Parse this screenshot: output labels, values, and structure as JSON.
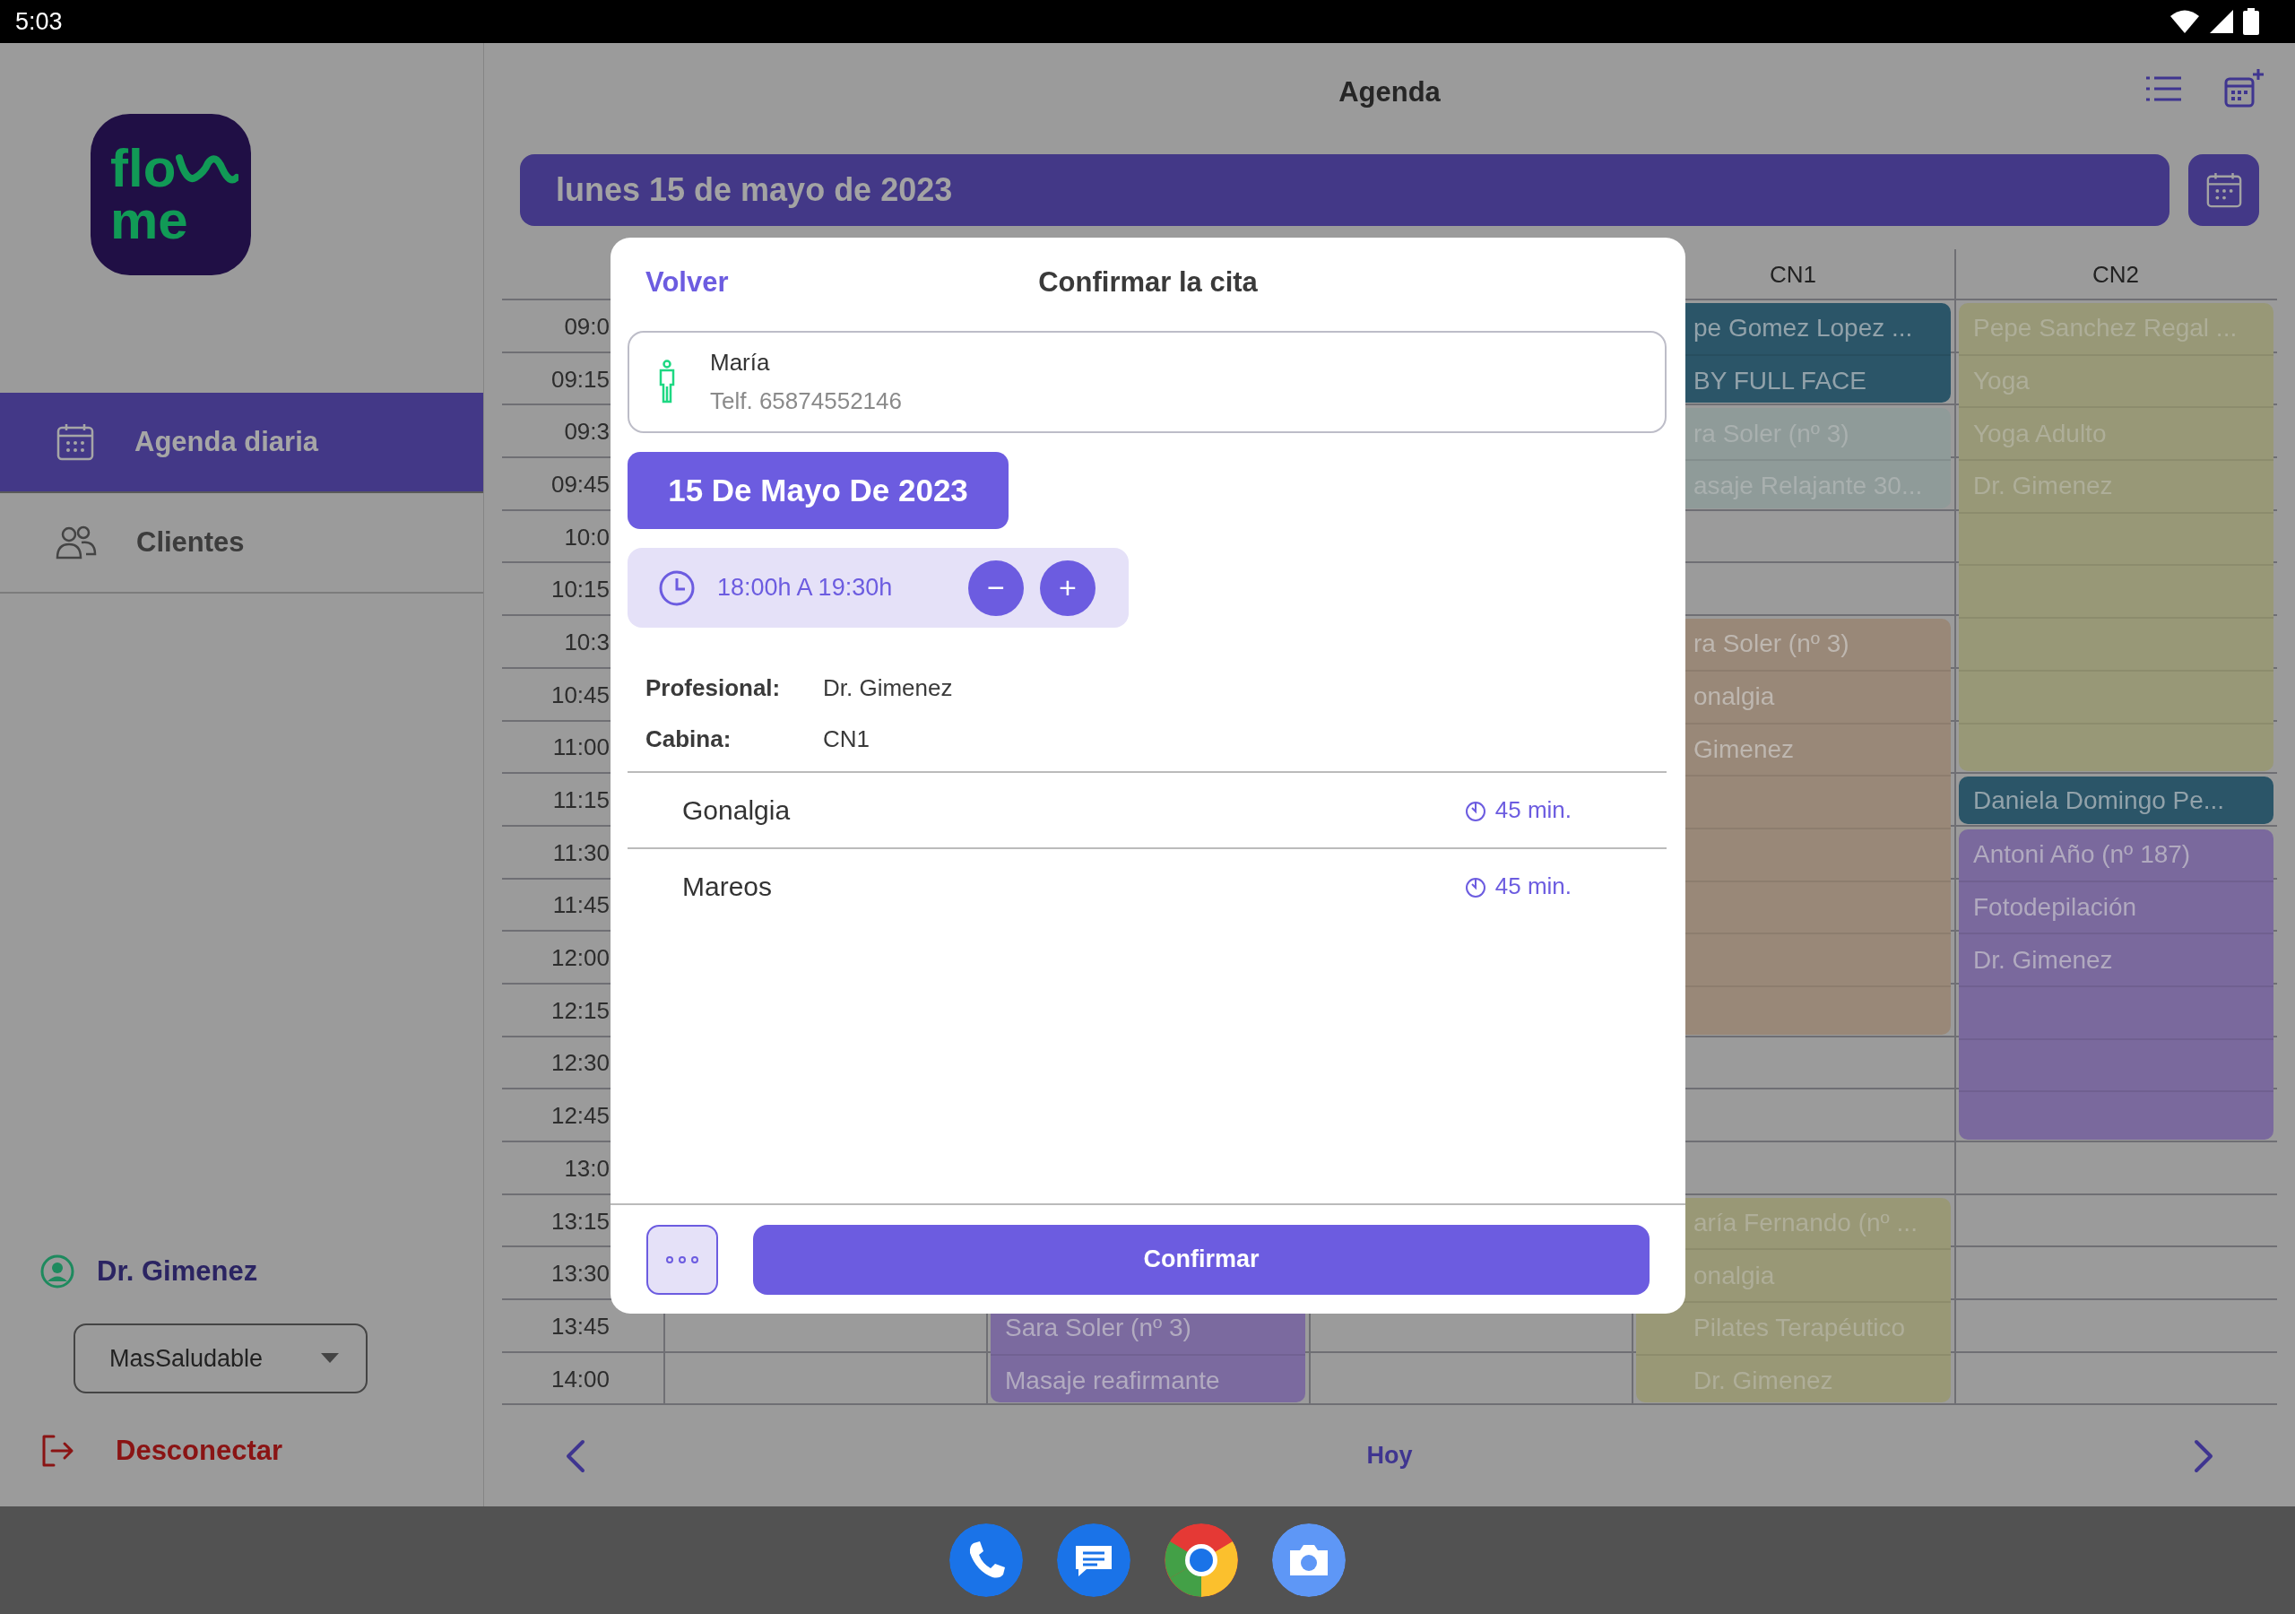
{
  "status_bar": {
    "time": "5:03"
  },
  "sidebar": {
    "logo": {
      "line_1": "flo",
      "line_2": "me"
    },
    "nav": [
      {
        "label": "Agenda diaria",
        "selected": true
      },
      {
        "label": "Clientes",
        "selected": false
      }
    ],
    "user": {
      "name": "Dr. Gimenez"
    },
    "center_select": {
      "value": "MasSaludable"
    },
    "logout": {
      "label": "Desconectar"
    }
  },
  "header": {
    "title": "Agenda"
  },
  "date_bar": {
    "label": "lunes 15 de mayo de 2023"
  },
  "calendar": {
    "times": [
      "09:0",
      "09:15",
      "09:3",
      "09:45",
      "10:0",
      "10:15",
      "10:3",
      "10:45",
      "11:00",
      "11:15",
      "11:30",
      "11:45",
      "12:00",
      "12:15",
      "12:30",
      "12:45",
      "13:0",
      "13:15",
      "13:30",
      "13:45",
      "14:00"
    ],
    "columns": [
      {
        "kind": "covered"
      },
      {
        "kind": "covered",
        "slots": [
          {
            "kind": "free"
          },
          {
            "kind": "free"
          },
          {
            "kind": "free"
          },
          {
            "kind": "free"
          },
          {
            "kind": "free"
          },
          {
            "kind": "free"
          },
          {
            "kind": "free"
          },
          {
            "kind": "free"
          },
          {
            "kind": "free"
          },
          {
            "kind": "free"
          },
          {
            "kind": "free"
          },
          {
            "kind": "free"
          },
          {
            "kind": "free"
          },
          {
            "kind": "free"
          },
          {
            "kind": "free"
          },
          {
            "kind": "free"
          },
          {
            "kind": "free"
          },
          {
            "kind": "free"
          },
          {
            "kind": "free"
          },
          {
            "kind": "appointment",
            "color": "#7b6a9f",
            "faded": false,
            "rows": [
              {
                "kind": "text",
                "text": "Sara Soler (nº 3)"
              },
              {
                "kind": "text",
                "text": "Masaje reafirmante"
              }
            ]
          }
        ]
      },
      {
        "kind": "covered"
      },
      {
        "kind": "named",
        "label": "CN1",
        "slots": [
          {
            "kind": "appointment",
            "color": "#2b5568",
            "faded": false,
            "rows": [
              {
                "kind": "text",
                "text": "pe Gomez Lopez ..."
              },
              {
                "kind": "text",
                "text": "BY FULL FACE"
              }
            ]
          },
          {
            "kind": "appointment",
            "color": "#8f9b99",
            "faded": true,
            "rows": [
              {
                "kind": "text",
                "text": "ra Soler (nº 3)"
              },
              {
                "kind": "text",
                "text": "asaje Relajante 30..."
              }
            ]
          },
          {
            "kind": "free"
          },
          {
            "kind": "free"
          },
          {
            "kind": "appointment",
            "color": "#998878",
            "faded": false,
            "rows": [
              {
                "kind": "text",
                "text": "ra Soler (nº 3)"
              },
              {
                "kind": "text",
                "text": "onalgia"
              },
              {
                "kind": "text",
                "text": "Gimenez"
              },
              {
                "kind": "blank"
              },
              {
                "kind": "blank"
              },
              {
                "kind": "blank"
              },
              {
                "kind": "blank"
              },
              {
                "kind": "blank"
              }
            ]
          },
          {
            "kind": "free"
          },
          {
            "kind": "free"
          },
          {
            "kind": "free"
          },
          {
            "kind": "appointment",
            "color": "#999876",
            "faded": true,
            "rows": [
              {
                "kind": "text",
                "text": "aría Fernando (nº ..."
              },
              {
                "kind": "text",
                "text": "onalgia"
              },
              {
                "kind": "text",
                "text": "Pilates Terapéutico"
              },
              {
                "kind": "text",
                "text": "Dr. Gimenez"
              }
            ]
          }
        ]
      },
      {
        "kind": "named",
        "label": "CN2",
        "slots": [
          {
            "kind": "appointment",
            "color": "#989877",
            "faded": true,
            "rows": [
              {
                "kind": "text",
                "text": "Pepe Sanchez Regal ..."
              },
              {
                "kind": "text",
                "text": "Yoga"
              },
              {
                "kind": "text",
                "text": "Yoga Adulto"
              },
              {
                "kind": "text",
                "text": "Dr. Gimenez"
              },
              {
                "kind": "blank"
              },
              {
                "kind": "blank"
              },
              {
                "kind": "blank"
              },
              {
                "kind": "blank"
              },
              {
                "kind": "blank"
              }
            ]
          },
          {
            "kind": "appointment",
            "color": "#2b5568",
            "faded": false,
            "rows": [
              {
                "kind": "text",
                "text": "Daniela Domingo Pe..."
              }
            ]
          },
          {
            "kind": "appointment",
            "color": "#7a699d",
            "faded": false,
            "rows": [
              {
                "kind": "text",
                "text": "Antoni Año (nº 187)"
              },
              {
                "kind": "text",
                "text": "Fotodepilación"
              },
              {
                "kind": "text",
                "text": "Dr. Gimenez"
              },
              {
                "kind": "blank"
              },
              {
                "kind": "blank"
              },
              {
                "kind": "blank"
              }
            ]
          }
        ]
      }
    ]
  },
  "bottom_nav": {
    "today": "Hoy"
  },
  "dialog": {
    "back": "Volver",
    "title": "Confirmar la cita",
    "client": {
      "name": "María",
      "phone": "Telf. 65874552146"
    },
    "date_button": "15 De Mayo De 2023",
    "time_range": "18:00h A 19:30h",
    "decrease": "−",
    "increase": "+",
    "details": [
      {
        "label": "Profesional:",
        "value": "Dr. Gimenez"
      },
      {
        "label": "Cabina:",
        "value": "CN1"
      }
    ],
    "services": [
      {
        "name": "Gonalgia",
        "duration": "45 min."
      },
      {
        "name": "Mareos",
        "duration": "45 min."
      }
    ],
    "confirm": "Confirmar"
  },
  "dock": [
    {
      "kind": "phone"
    },
    {
      "kind": "messages"
    },
    {
      "kind": "browser"
    },
    {
      "kind": "camera"
    }
  ]
}
